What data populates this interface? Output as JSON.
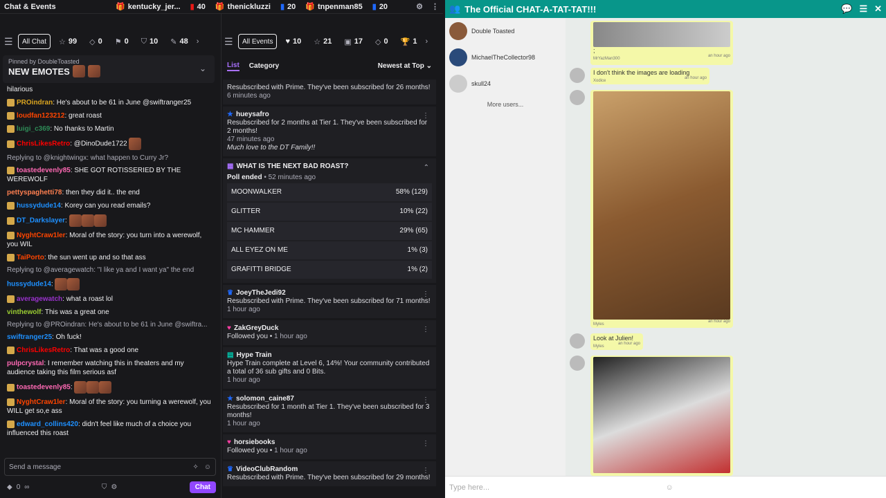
{
  "window": {
    "title": "Chat & Events"
  },
  "leaderboard": [
    {
      "name": "kentucky_jer...",
      "count": ""
    },
    {
      "name": "",
      "count": "40"
    },
    {
      "name": "thenickluzzi",
      "count": ""
    },
    {
      "name": "",
      "count": "20"
    },
    {
      "name": "tnpenman85",
      "count": ""
    },
    {
      "name": "",
      "count": "20"
    }
  ],
  "chat_filter": {
    "all_chat": "All Chat",
    "counts": [
      "99",
      "0",
      "0",
      "10",
      "48"
    ]
  },
  "events_filter": {
    "all_events": "All Events",
    "counts": [
      "10",
      "21",
      "17",
      "0",
      "1"
    ]
  },
  "pinned": {
    "label": "Pinned by",
    "by": "DoubleToasted",
    "text": "NEW EMOTES"
  },
  "chat": [
    {
      "user": "",
      "text": "hilarious",
      "color": "#adadb8"
    },
    {
      "user": "PROindran",
      "text": ": He's about to be 61 in June @swiftranger25",
      "color": "#daa520"
    },
    {
      "user": "loudfan123212",
      "text": ": great roast",
      "color": "#ff4500"
    },
    {
      "user": "luigi_c369",
      "text": ": No thanks to Martin",
      "color": "#2e8b57"
    },
    {
      "user": "ChrisLikesRetro",
      "text": ": @DinoDude1722",
      "color": "#ff0000"
    },
    {
      "reply": "Replying to @knightwingx: what happen to Curry Jr?"
    },
    {
      "user": "toastedevenly85",
      "text": ": SHE GOT ROTISSERIED BY THE WEREWOLF",
      "color": "#ff69b4"
    },
    {
      "user": "pettyspaghetti78",
      "text": ": then they did it.. the end",
      "color": "#ff7f50"
    },
    {
      "user": "hussydude14",
      "text": ": Korey can you read emails?",
      "color": "#1e90ff"
    },
    {
      "user": "DT_Darkslayer",
      "text": ":",
      "color": "#1e90ff"
    },
    {
      "user": "NyghtCraw1ler",
      "text": ": Moral of the story: you turn into a werewolf, you WIL",
      "color": "#ff4500"
    },
    {
      "user": "TaiPorto",
      "text": ": the sun went up and so that ass",
      "color": "#ff4500"
    },
    {
      "reply": "Replying to @averagewatch: \"I like ya and I want ya\" the end"
    },
    {
      "user": "hussydude14",
      "text": ":",
      "color": "#1e90ff"
    },
    {
      "user": "averagewatch",
      "text": ": what a roast lol",
      "color": "#9932cc"
    },
    {
      "user": "vinthewolf",
      "text": ": This was a great one",
      "color": "#9acd32"
    },
    {
      "reply": "Replying to @PROindran: He's about to be 61 in June @swiftra..."
    },
    {
      "user": "swiftranger25",
      "text": ": Oh fuck!",
      "color": "#1e90ff"
    },
    {
      "user": "ChrisLikesRetro",
      "text": ": That was a good one",
      "color": "#ff0000"
    },
    {
      "user": "pulpcrystal",
      "text": ": I remember watching this in theaters and my audience taking this film serious asf",
      "color": "#ff69b4"
    },
    {
      "user": "toastedevenly85",
      "text": ":",
      "color": "#ff69b4"
    },
    {
      "user": "NyghtCraw1ler",
      "text": ": Moral of the story: you turning a werewolf, you WILL get so,e ass",
      "color": "#ff4500"
    },
    {
      "user": "edward_collins420",
      "text": ": didn't feel like much of a choice you influenced this roast",
      "color": "#1e90ff"
    }
  ],
  "input": {
    "placeholder": "Send a message"
  },
  "bottom": {
    "points": "0",
    "chat_button": "Chat"
  },
  "events_header": {
    "tab_list": "List",
    "tab_category": "Category",
    "sort": "Newest at Top"
  },
  "events": [
    {
      "type": "sub-partial",
      "text": "Resubscribed with Prime. They've been subscribed for 26 months!",
      "time": "6 minutes ago"
    },
    {
      "type": "sub",
      "name": "hueysafro",
      "text": "Resubscribed for 2 months at Tier 1. They've been subscribed for 2 months!",
      "time": "47 minutes ago",
      "note": "Much love to the DT Family!!"
    },
    {
      "type": "poll",
      "name": "WHAT IS THE NEXT BAD ROAST?",
      "status": "Poll ended",
      "time": "52 minutes ago",
      "options": [
        {
          "label": "MOONWALKER",
          "result": "58% (129)"
        },
        {
          "label": "GLITTER",
          "result": "10% (22)"
        },
        {
          "label": "MC HAMMER",
          "result": "29% (65)"
        },
        {
          "label": "ALL EYEZ ON ME",
          "result": "1% (3)"
        },
        {
          "label": "GRAFITTI BRIDGE",
          "result": "1% (2)"
        }
      ]
    },
    {
      "type": "sub",
      "name": "JoeyTheJedi92",
      "text": "Resubscribed with Prime. They've been subscribed for 71 months!",
      "time": "1 hour ago"
    },
    {
      "type": "follow",
      "name": "ZakGreyDuck",
      "text": "Followed you",
      "time": "1 hour ago"
    },
    {
      "type": "hype",
      "name": "Hype Train",
      "text": "Hype Train complete at Level 6, 14%! Your community contributed a total of 36 sub gifts and 0 Bits.",
      "time": "1 hour ago"
    },
    {
      "type": "sub",
      "name": "solomon_caine87",
      "text": "Resubscribed for 1 month at Tier 1. They've been subscribed for 3 months!",
      "time": "1 hour ago"
    },
    {
      "type": "follow",
      "name": "horsiebooks",
      "text": "Followed you",
      "time": "1 hour ago"
    },
    {
      "type": "sub",
      "name": "VideoClubRandom",
      "text": "Resubscribed with Prime. They've been subscribed for 29 months!",
      "time": "1 hour ago"
    }
  ],
  "right": {
    "title": "The Official CHAT-A-TAT-TAT!!!",
    "badge": "0",
    "users": [
      "Double Toasted",
      "MichaelTheCollector98",
      "skull24"
    ],
    "more": "More users...",
    "messages": [
      {
        "name": "MrYazMan300",
        "text": ";",
        "time": "an hour ago"
      },
      {
        "name": "Xodice",
        "text": "I don't think the images are loading",
        "time": "an hour ago"
      },
      {
        "name": "Myles",
        "text": "",
        "time": "an hour ago"
      },
      {
        "name": "Myles",
        "text": "Look at Julien!",
        "time": "an hour ago"
      }
    ],
    "type_placeholder": "Type here..."
  }
}
